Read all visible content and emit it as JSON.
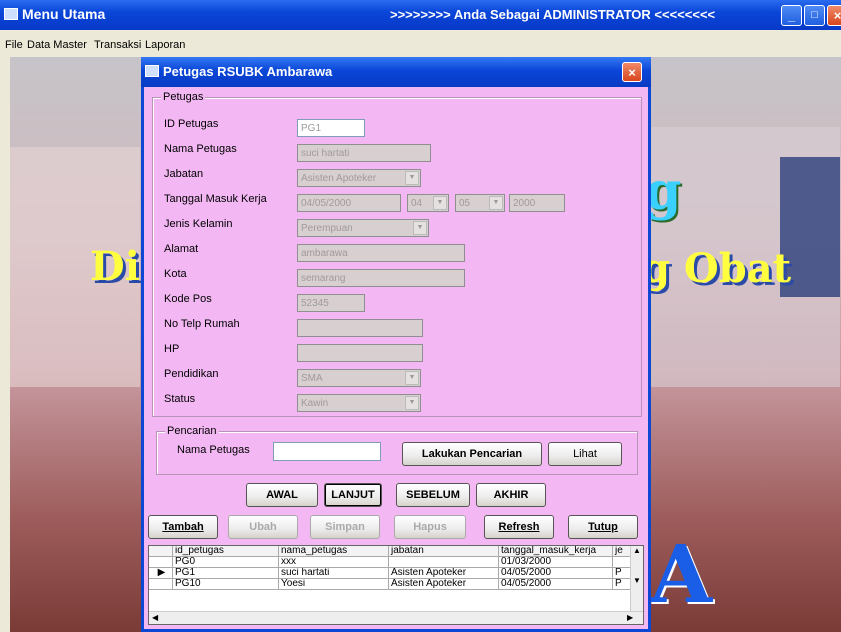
{
  "main_window": {
    "title": "Menu Utama",
    "caption": ">>>>>>>> Anda Sebagai ADMINISTRATOR <<<<<<<<",
    "controls": {
      "minimize": "_",
      "maximize": "□",
      "close": "×"
    }
  },
  "menu": [
    "File",
    "Data Master",
    "Transaksi",
    "Laporan"
  ],
  "background_text": {
    "left_big": "Di",
    "right_line1": "g",
    "right_line2": "g Obat",
    "bottom": "A"
  },
  "dialog": {
    "title": "Petugas RSUBK Ambarawa",
    "close": "×",
    "group_label": "Petugas",
    "fields": [
      {
        "label": "ID Petugas",
        "value": "PG1"
      },
      {
        "label": "Nama Petugas",
        "value": "suci hartati"
      },
      {
        "label": "Jabatan",
        "value": "Asisten Apoteker"
      },
      {
        "label": "Tanggal Masuk Kerja",
        "value": "04/05/2000",
        "day": "04",
        "month": "05",
        "year": "2000"
      },
      {
        "label": "Jenis Kelamin",
        "value": "Perempuan"
      },
      {
        "label": "Alamat",
        "value": "ambarawa"
      },
      {
        "label": "Kota",
        "value": "semarang"
      },
      {
        "label": "Kode Pos",
        "value": "52345"
      },
      {
        "label": "No Telp Rumah",
        "value": ""
      },
      {
        "label": "HP",
        "value": ""
      },
      {
        "label": "Pendidikan",
        "value": "SMA"
      },
      {
        "label": "Status",
        "value": "Kawin"
      }
    ],
    "search": {
      "group_label": "Pencarian",
      "label": "Nama Petugas",
      "value": "",
      "search_button": "Lakukan Pencarian",
      "view_button": "Lihat"
    },
    "nav": {
      "first": "AWAL",
      "next": "LANJUT",
      "prev": "SEBELUM",
      "last": "AKHIR"
    },
    "actions": {
      "add": "Tambah",
      "edit": "Ubah",
      "save": "Simpan",
      "delete": "Hapus",
      "refresh": "Refresh",
      "close": "Tutup"
    },
    "grid": {
      "headers": [
        "id_petugas",
        "nama_petugas",
        "jabatan",
        "tanggal_masuk_kerja",
        "je"
      ],
      "rows": [
        [
          "PG0",
          "xxx",
          "",
          "01/03/2000",
          ""
        ],
        [
          "PG1",
          "suci hartati",
          "Asisten Apoteker",
          "04/05/2000",
          "P"
        ],
        [
          "PG10",
          "Yoesi",
          "Asisten Apoteker",
          "04/05/2000",
          "P"
        ]
      ]
    }
  }
}
